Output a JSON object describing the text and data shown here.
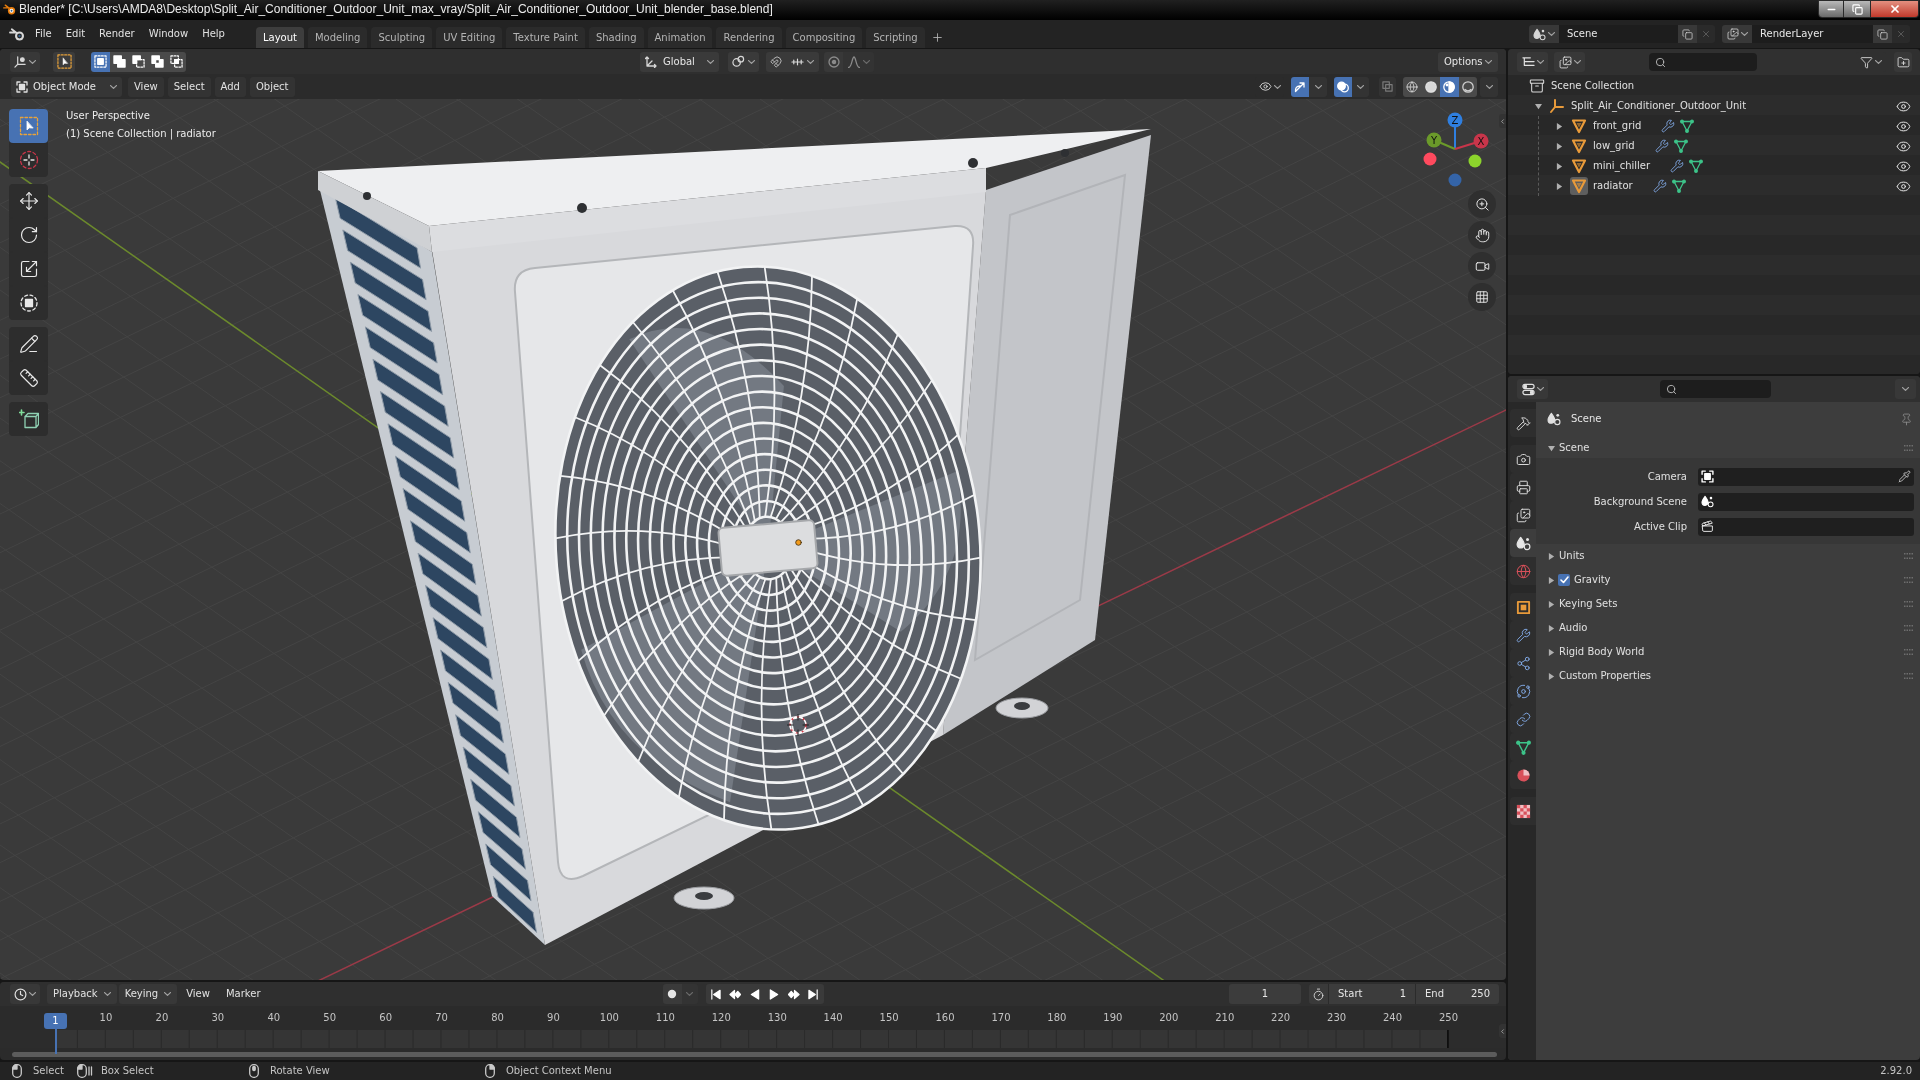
{
  "window": {
    "title": "Blender* [C:\\Users\\AMDA8\\Desktop\\Split_Air_Conditioner_Outdoor_Unit_max_vray/Split_Air_Conditioner_Outdoor_Unit_blender_base.blend]"
  },
  "menu": [
    "File",
    "Edit",
    "Render",
    "Window",
    "Help"
  ],
  "workspaces": [
    {
      "label": "Layout",
      "selected": true
    },
    {
      "label": "Modeling",
      "selected": false
    },
    {
      "label": "Sculpting",
      "selected": false
    },
    {
      "label": "UV Editing",
      "selected": false
    },
    {
      "label": "Texture Paint",
      "selected": false
    },
    {
      "label": "Shading",
      "selected": false
    },
    {
      "label": "Animation",
      "selected": false
    },
    {
      "label": "Rendering",
      "selected": false
    },
    {
      "label": "Compositing",
      "selected": false
    },
    {
      "label": "Scripting",
      "selected": false
    }
  ],
  "scene": {
    "value": "Scene"
  },
  "view_layer": {
    "value": "RenderLayer"
  },
  "viewport": {
    "select_modes": [
      {
        "selected": true
      },
      {
        "selected": false
      },
      {
        "selected": false
      },
      {
        "selected": false
      },
      {
        "selected": false
      }
    ],
    "orientation": "Global",
    "snap": {
      "on": false
    },
    "proportional": {
      "on": false
    },
    "options": "Options",
    "mode": "Object Mode",
    "menus": [
      "View",
      "Select",
      "Add",
      "Object"
    ],
    "gizmos": {
      "on": true
    },
    "overlays": {
      "on": true
    },
    "xray": {
      "on": false
    },
    "shading": [
      {
        "selected": false
      },
      {
        "selected": false
      },
      {
        "selected": true
      },
      {
        "selected": false
      }
    ],
    "tools": [
      {
        "selected": true
      },
      {
        "selected": false
      },
      {
        "selected": false
      },
      {
        "selected": false
      },
      {
        "selected": false
      },
      {
        "selected": false
      },
      {
        "selected": false
      },
      {
        "selected": false
      },
      {
        "selected": false
      }
    ],
    "info": [
      "User Perspective",
      "(1) Scene Collection | radiator"
    ],
    "axes": [
      {
        "label": "Z",
        "color": "#2f7fe0"
      },
      {
        "label": "Y",
        "color": "#6b9a2a"
      },
      {
        "label": "X",
        "color": "#c8354a"
      }
    ]
  },
  "outliner": {
    "root": "Scene Collection",
    "items": [
      {
        "label": "Split_Air_Conditioner_Outdoor_Unit",
        "kind": "empty",
        "expanded": true,
        "selected": false,
        "visible": true,
        "children": [
          {
            "label": "front_grid",
            "kind": "mesh",
            "expanded": false,
            "selected": false,
            "visible": true
          },
          {
            "label": "low_grid",
            "kind": "mesh",
            "expanded": false,
            "selected": false,
            "visible": true
          },
          {
            "label": "mini_chiller",
            "kind": "mesh",
            "expanded": false,
            "selected": false,
            "visible": true
          },
          {
            "label": "radiator",
            "kind": "mesh",
            "expanded": false,
            "selected": true,
            "visible": true
          }
        ]
      }
    ]
  },
  "properties": {
    "tabs": [
      {
        "selected": false
      },
      {
        "selected": false
      },
      {
        "selected": false
      },
      {
        "selected": false
      },
      {
        "selected": true
      },
      {
        "selected": false
      },
      {
        "selected": false
      },
      {
        "selected": false
      },
      {
        "selected": false
      },
      {
        "selected": false
      },
      {
        "selected": false
      },
      {
        "selected": false
      },
      {
        "selected": false
      },
      {
        "selected": false
      }
    ],
    "context": "Scene",
    "panels": [
      {
        "title": "Scene",
        "kind": "plain",
        "expanded": true,
        "fields": [
          "Camera",
          "Background Scene",
          "Active Clip"
        ]
      },
      {
        "title": "Units",
        "kind": "plain",
        "expanded": false
      },
      {
        "title": "Gravity",
        "kind": "checkbox",
        "checked": true,
        "expanded": false
      },
      {
        "title": "Keying Sets",
        "kind": "plain",
        "expanded": false
      },
      {
        "title": "Audio",
        "kind": "plain",
        "expanded": false
      },
      {
        "title": "Rigid Body World",
        "kind": "plain",
        "expanded": false
      },
      {
        "title": "Custom Properties",
        "kind": "plain",
        "expanded": false
      }
    ]
  },
  "timeline": {
    "menus": [
      {
        "label": "Playback",
        "kind": "dropdown"
      },
      {
        "label": "Keying",
        "kind": "dropdown"
      },
      {
        "label": "View",
        "kind": "menu"
      },
      {
        "label": "Marker",
        "kind": "menu"
      }
    ],
    "auto_keying": {
      "on": false
    },
    "current_frame": "1",
    "preview_range": {
      "on": false
    },
    "start": {
      "label": "Start",
      "value": "1"
    },
    "end": {
      "label": "End",
      "value": "250"
    },
    "playhead": "1",
    "ruler": [
      "10",
      "20",
      "30",
      "40",
      "50",
      "60",
      "70",
      "80",
      "90",
      "100",
      "110",
      "120",
      "130",
      "140",
      "150",
      "160",
      "170",
      "180",
      "190",
      "200",
      "210",
      "220",
      "230",
      "240",
      "250"
    ]
  },
  "status_bar": {
    "hints": [
      "Select",
      "Box Select",
      "Rotate View",
      "Object Context Menu"
    ],
    "version": "2.92.0"
  }
}
